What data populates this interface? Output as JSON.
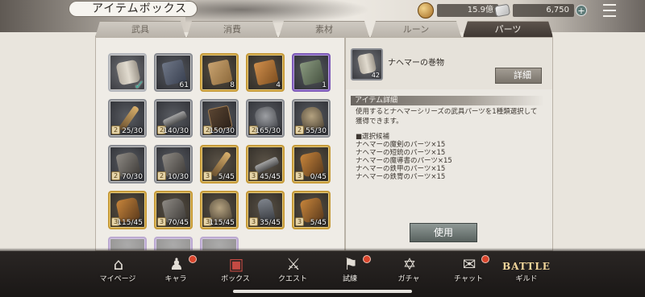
{
  "header": {
    "title": "アイテムボックス",
    "gold": "15.9億",
    "gems": "6,750",
    "plus_label": "+"
  },
  "tabs": [
    {
      "label": "武具",
      "active": false
    },
    {
      "label": "消費",
      "active": false
    },
    {
      "label": "素材",
      "active": false
    },
    {
      "label": "ルーン",
      "active": false
    },
    {
      "label": "パーツ",
      "active": true
    }
  ],
  "items": [
    {
      "icon": "scroll",
      "frame": "selected",
      "count": "",
      "checked": true
    },
    {
      "icon": "book",
      "frame": "silver",
      "count": "61"
    },
    {
      "icon": "map",
      "frame": "gold",
      "count": "8"
    },
    {
      "icon": "orange",
      "frame": "gold",
      "count": "4"
    },
    {
      "icon": "green",
      "frame": "purple",
      "count": "1"
    },
    {
      "icon": "sword",
      "frame": "silver",
      "count": "25/30",
      "badge": "2"
    },
    {
      "icon": "gun",
      "frame": "silver",
      "count": "140/30",
      "badge": "2"
    },
    {
      "icon": "tome",
      "frame": "silver",
      "count": "150/30",
      "badge": "2"
    },
    {
      "icon": "armor",
      "frame": "silver",
      "count": "165/30",
      "badge": "2"
    },
    {
      "icon": "helm",
      "frame": "silver",
      "count": "55/30",
      "badge": "2"
    },
    {
      "icon": "boots",
      "frame": "silver",
      "count": "70/30",
      "badge": "2"
    },
    {
      "icon": "boots",
      "frame": "silver",
      "count": "10/30",
      "badge": "2"
    },
    {
      "icon": "sword",
      "frame": "gold",
      "count": "5/45",
      "badge": "3"
    },
    {
      "icon": "gun",
      "frame": "gold",
      "count": "45/45",
      "badge": "3"
    },
    {
      "icon": "cloth",
      "frame": "gold",
      "count": "0/45",
      "badge": "3"
    },
    {
      "icon": "cloth",
      "frame": "gold",
      "count": "115/45",
      "badge": "3"
    },
    {
      "icon": "boots",
      "frame": "gold",
      "count": "70/45",
      "badge": "3"
    },
    {
      "icon": "helm",
      "frame": "gold",
      "count": "115/45",
      "badge": "3"
    },
    {
      "icon": "figure",
      "frame": "gold",
      "count": "35/45",
      "badge": "3"
    },
    {
      "icon": "cloth",
      "frame": "gold",
      "count": "5/45",
      "badge": "3"
    }
  ],
  "detail": {
    "name": "ナヘマーの巻物",
    "count": "42",
    "detail_button": "詳細",
    "section_title": "アイテム詳細",
    "description_line1": "使用するとナヘマーシリーズの武具パーツを1種類選択して",
    "description_line2": "獲得できます。",
    "candidates_title": "■選択候補",
    "candidates": [
      "ナヘマーの魔剣のパーツ×15",
      "ナヘマーの短銃のパーツ×15",
      "ナヘマーの魔導書のパーツ×15",
      "ナヘマーの鉄甲のパーツ×15",
      "ナヘマーの鉄冑のパーツ×15"
    ],
    "use_button": "使用"
  },
  "nav": [
    {
      "label": "マイページ",
      "icon": "home-icon",
      "glyph": "⌂",
      "dot": false,
      "active": false
    },
    {
      "label": "キャラ",
      "icon": "characters-icon",
      "glyph": "♟",
      "dot": true,
      "active": false
    },
    {
      "label": "ボックス",
      "icon": "box-icon",
      "glyph": "▣",
      "dot": false,
      "active": true
    },
    {
      "label": "クエスト",
      "icon": "crossed-swords-icon",
      "glyph": "⚔",
      "dot": false,
      "active": false
    },
    {
      "label": "試練",
      "icon": "flag-icon",
      "glyph": "⚑",
      "dot": true,
      "active": false
    },
    {
      "label": "ガチャ",
      "icon": "summon-circle-icon",
      "glyph": "✡",
      "dot": false,
      "active": false
    },
    {
      "label": "チャット",
      "icon": "chat-icon",
      "glyph": "✉",
      "dot": true,
      "active": false
    },
    {
      "label": "ギルド",
      "icon": "battle-guild-icon",
      "glyph": "BATTLE",
      "dot": false,
      "active": false
    }
  ]
}
